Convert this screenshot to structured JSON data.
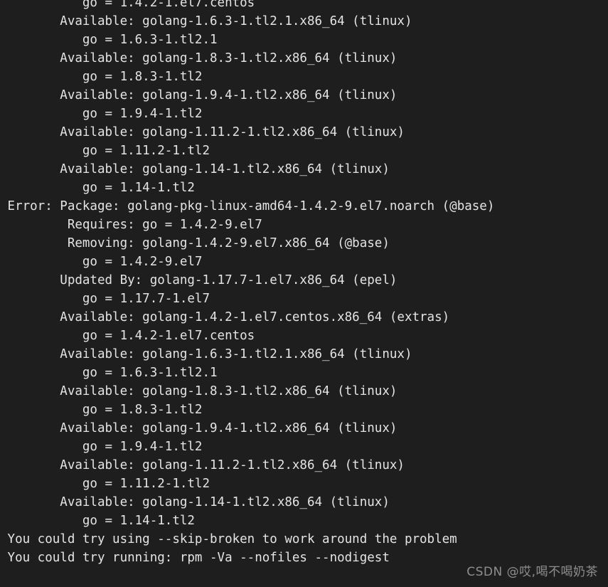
{
  "terminal": {
    "background_color": "#1e1e1e",
    "text_color": "#e4e4e4",
    "lines": [
      "           go = 1.4.2-1.el7.centos",
      "        Available: golang-1.6.3-1.tl2.1.x86_64 (tlinux)",
      "           go = 1.6.3-1.tl2.1",
      "        Available: golang-1.8.3-1.tl2.x86_64 (tlinux)",
      "           go = 1.8.3-1.tl2",
      "        Available: golang-1.9.4-1.tl2.x86_64 (tlinux)",
      "           go = 1.9.4-1.tl2",
      "        Available: golang-1.11.2-1.tl2.x86_64 (tlinux)",
      "           go = 1.11.2-1.tl2",
      "        Available: golang-1.14-1.tl2.x86_64 (tlinux)",
      "           go = 1.14-1.tl2",
      " Error: Package: golang-pkg-linux-amd64-1.4.2-9.el7.noarch (@base)",
      "         Requires: go = 1.4.2-9.el7",
      "         Removing: golang-1.4.2-9.el7.x86_64 (@base)",
      "           go = 1.4.2-9.el7",
      "        Updated By: golang-1.17.7-1.el7.x86_64 (epel)",
      "           go = 1.17.7-1.el7",
      "        Available: golang-1.4.2-1.el7.centos.x86_64 (extras)",
      "           go = 1.4.2-1.el7.centos",
      "        Available: golang-1.6.3-1.tl2.1.x86_64 (tlinux)",
      "           go = 1.6.3-1.tl2.1",
      "        Available: golang-1.8.3-1.tl2.x86_64 (tlinux)",
      "           go = 1.8.3-1.tl2",
      "        Available: golang-1.9.4-1.tl2.x86_64 (tlinux)",
      "           go = 1.9.4-1.tl2",
      "        Available: golang-1.11.2-1.tl2.x86_64 (tlinux)",
      "           go = 1.11.2-1.tl2",
      "        Available: golang-1.14-1.tl2.x86_64 (tlinux)",
      "           go = 1.14-1.tl2",
      " You could try using --skip-broken to work around the problem",
      " You could try running: rpm -Va --nofiles --nodigest"
    ]
  },
  "watermark": {
    "text": "CSDN @哎,喝不喝奶茶",
    "color": "#8e8e8e"
  }
}
